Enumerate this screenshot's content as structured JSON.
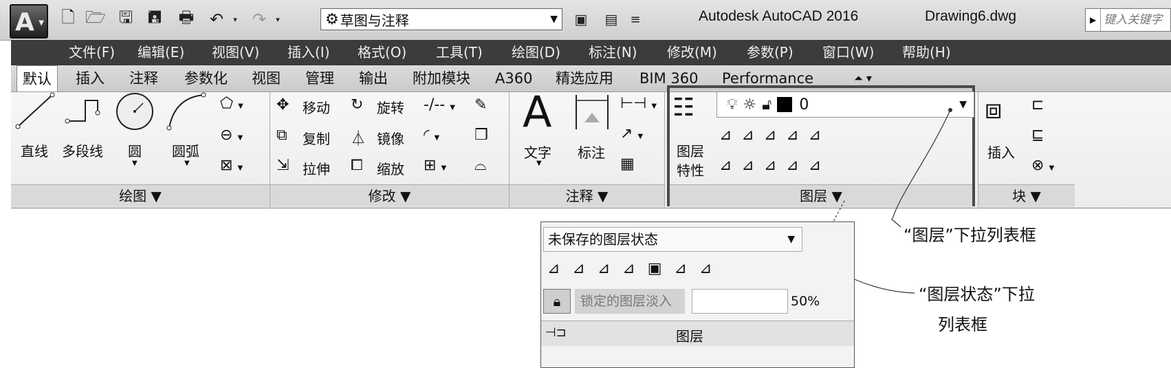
{
  "titlebar": {
    "app_letter": "A",
    "quick_access": [
      "new-file-icon",
      "open-folder-icon",
      "save-icon",
      "save-as-icon",
      "print-icon",
      "undo-icon",
      "redo-icon"
    ],
    "workspace": "草图与注释",
    "app_title": "Autodesk AutoCAD 2016",
    "file_title": "Drawing6.dwg",
    "search_placeholder": "键入关键字"
  },
  "menu": [
    "文件(F)",
    "编辑(E)",
    "视图(V)",
    "插入(I)",
    "格式(O)",
    "工具(T)",
    "绘图(D)",
    "标注(N)",
    "修改(M)",
    "参数(P)",
    "窗口(W)",
    "帮助(H)"
  ],
  "tabs": [
    "默认",
    "插入",
    "注释",
    "参数化",
    "视图",
    "管理",
    "输出",
    "附加模块",
    "A360",
    "精选应用",
    "BIM 360",
    "Performance"
  ],
  "panels": {
    "draw": {
      "title": "绘图",
      "tools": [
        "直线",
        "多段线",
        "圆",
        "圆弧"
      ]
    },
    "modify": {
      "title": "修改",
      "tools": [
        "移动",
        "旋转",
        "复制",
        "镜像",
        "拉伸",
        "缩放"
      ]
    },
    "annotation": {
      "title": "注释",
      "tools": [
        "文字",
        "标注"
      ]
    },
    "layers": {
      "title": "图层",
      "properties_line1": "图层",
      "properties_line2": "特性",
      "current_layer": "0"
    },
    "block": {
      "title": "块",
      "insert": "插入"
    }
  },
  "popup": {
    "layer_state": "未保存的图层状态",
    "fade_label": "锁定的图层淡入",
    "fade_value": "50%",
    "footer_title": "图层"
  },
  "callouts": {
    "layer_dropdown": "“图层”下拉列表框",
    "layer_state_line1": "“图层状态”下拉",
    "layer_state_line2": "列表框"
  }
}
